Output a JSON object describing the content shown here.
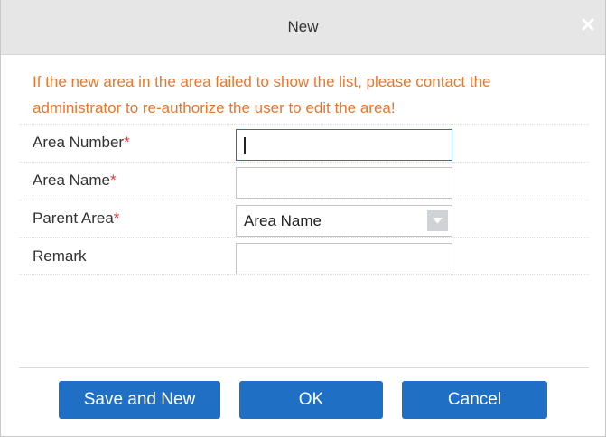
{
  "dialog": {
    "title": "New",
    "close_label": "×"
  },
  "notice": {
    "text": "If the new area in the area failed to show the list, please contact the administrator to re-authorize the user to edit the area!",
    "color": "#e8772e"
  },
  "form": {
    "required_marker": "*",
    "fields": [
      {
        "label": "Area Number",
        "required": true,
        "value": "",
        "focused": true
      },
      {
        "label": "Area Name",
        "required": true,
        "value": ""
      },
      {
        "label": "Parent Area",
        "required": true,
        "selected": "Area Name"
      },
      {
        "label": "Remark",
        "required": false,
        "value": ""
      }
    ]
  },
  "buttons": {
    "save_and_new": "Save and New",
    "ok": "OK",
    "cancel": "Cancel",
    "color": "#1f6fc5"
  },
  "icons": {
    "close": "close-icon",
    "dropdown": "chevron-down-icon"
  }
}
